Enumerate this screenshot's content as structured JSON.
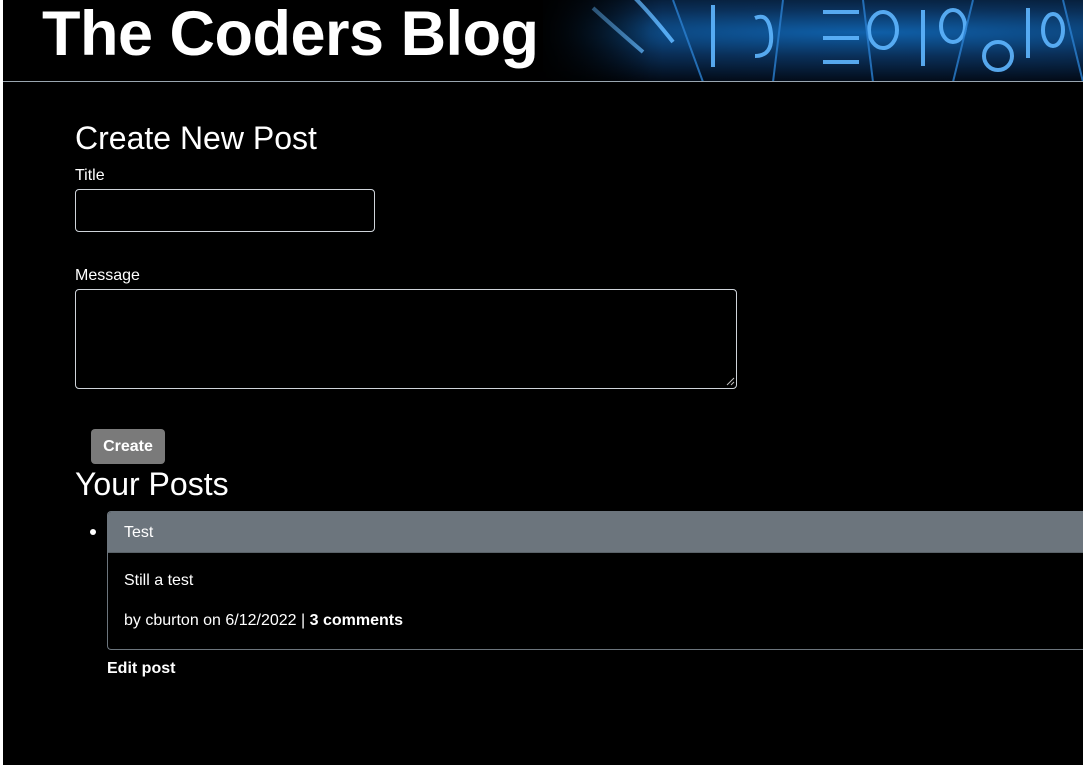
{
  "header": {
    "site_title": "The Coders Blog",
    "banner_image": "binary-code-banner"
  },
  "create_form": {
    "heading": "Create New Post",
    "title_label": "Title",
    "title_value": "",
    "message_label": "Message",
    "message_value": "",
    "submit_label": "Create"
  },
  "posts_section": {
    "heading": "Your Posts",
    "posts": [
      {
        "title": "Test",
        "body": "Still a test",
        "meta_prefix": "by cburton on 6/12/2022 | ",
        "comments_label": "3 comments",
        "edit_label": "Edit post"
      }
    ]
  },
  "colors": {
    "background": "#000000",
    "text": "#ffffff",
    "card_header": "#6c757d",
    "button": "#7a7a7a"
  }
}
